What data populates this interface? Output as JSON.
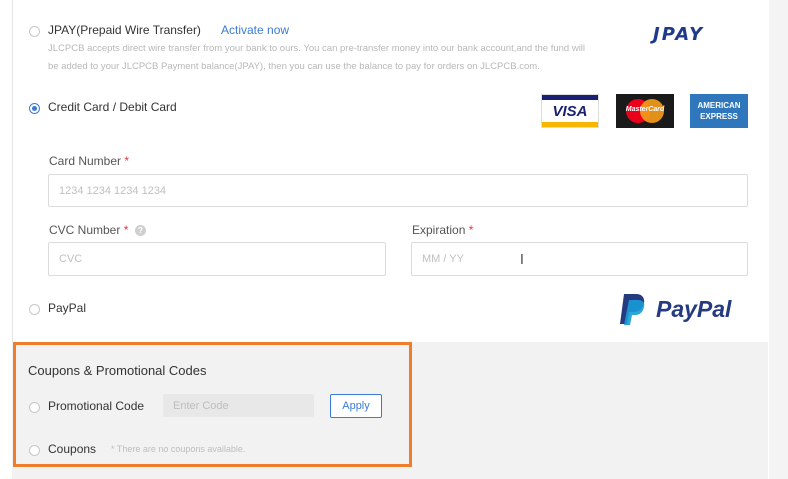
{
  "jpay": {
    "label": "JPAY(Prepaid Wire Transfer)",
    "activate_link": "Activate now",
    "description_line1": "JLCPCB accepts direct wire transfer from your bank to ours. You can pre-transfer money into our bank account,and the fund will",
    "description_line2": "be added to your JLCPCB Payment balance(JPAY), then you can use the balance to pay for orders on JLCPCB.com.",
    "logo_text": "JPAY",
    "selected": false
  },
  "credit_card": {
    "label": "Credit Card / Debit Card",
    "selected": true,
    "card_logos": [
      {
        "name": "visa",
        "text": "VISA"
      },
      {
        "name": "mastercard",
        "text": "MasterCard"
      },
      {
        "name": "amex",
        "text_line1": "AMERICAN",
        "text_line2": "EXPRESS"
      }
    ],
    "card_number_label": "Card Number",
    "card_number_placeholder": "1234 1234 1234 1234",
    "cvc_label": "CVC Number",
    "cvc_placeholder": "CVC",
    "expiration_label": "Expiration",
    "expiration_placeholder": "MM / YY",
    "required_mark": "*"
  },
  "paypal": {
    "label": "PayPal",
    "logo_text": "PayPal",
    "selected": false
  },
  "coupons": {
    "section_title": "Coupons & Promotional Codes",
    "promo_label": "Promotional Code",
    "promo_placeholder": "Enter Code",
    "apply_label": "Apply",
    "coupons_label": "Coupons",
    "coupons_note": "* There are no coupons available."
  },
  "colors": {
    "accent": "#3a7bd5",
    "highlight_box": "#ef7d2e",
    "required": "#e4393c"
  }
}
